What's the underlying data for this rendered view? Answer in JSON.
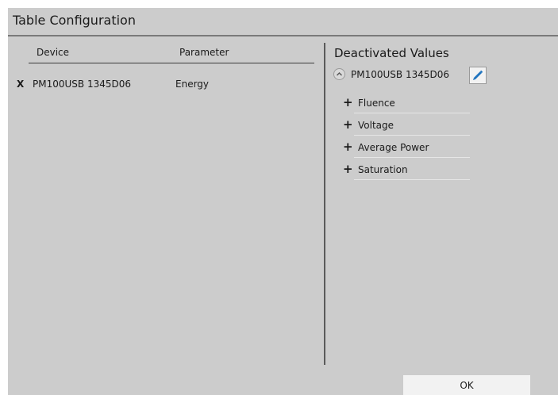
{
  "dialog": {
    "title": "Table Configuration"
  },
  "table": {
    "columns": [
      "Device",
      "Parameter"
    ],
    "rows": [
      {
        "remove_label": "X",
        "device": "PM100USB 1345D06",
        "parameter": "Energy"
      }
    ]
  },
  "deactivated": {
    "title": "Deactivated Values",
    "device": "PM100USB 1345D06",
    "collapse_icon": "chevron-up-icon",
    "edit_icon": "pencil-icon",
    "values": [
      "Fluence",
      "Voltage",
      "Average Power",
      "Saturation"
    ],
    "add_symbol": "+"
  },
  "footer": {
    "ok_label": "OK"
  },
  "colors": {
    "background": "#cccccc",
    "button": "#f2f2f2",
    "pencil": "#1e73be"
  }
}
